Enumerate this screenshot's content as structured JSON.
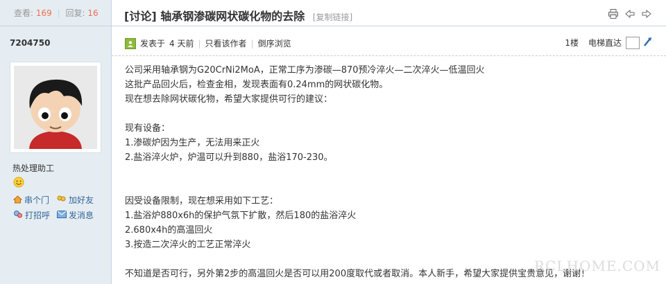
{
  "sidebar": {
    "views_label": "查看:",
    "views_count": "169",
    "replies_label": "回复:",
    "replies_count": "16",
    "username": "7204750",
    "usergroup": "热处理助工",
    "actions": {
      "visit": "串个门",
      "add_friend": "加好友",
      "greet": "打招呼",
      "message": "发消息"
    }
  },
  "thread": {
    "title": "[讨论] 轴承钢渗碳网状碳化物的去除",
    "copy_link": "[复制链接]"
  },
  "post_meta": {
    "posted_prefix": "发表于",
    "posted_time": "4 天前",
    "only_author": "只看该作者",
    "reverse_order": "倒序浏览",
    "floor": "1楼",
    "goto_label": "电梯直达"
  },
  "post": {
    "lines": [
      "公司采用轴承钢为G20CrNi2MoA，正常工序为渗碳—870预冷淬火—二次淬火—低温回火",
      "这批产品回火后，检查金相，发现表面有0.24mm的网状碳化物。",
      "现在想去除网状碳化物，希望大家提供可行的建议：",
      "",
      "现有设备：",
      "1.渗碳炉因为生产，无法用来正火",
      "2.盐浴淬火炉，炉温可以升到880，盐浴170-230。",
      "",
      "",
      "因受设备限制，现在想采用如下工艺：",
      "1.盐浴炉880x6h的保护气氛下扩散，然后180的盐浴淬火",
      "2.680x4h的高温回火",
      "3.按造二次淬火的工艺正常淬火",
      "",
      "不知道是否可行，另外第2步的高温回火是否可以用200度取代或者取消。本人新手，希望大家提供宝贵意见，谢谢！"
    ]
  },
  "watermark": "RCLHOME.COM"
}
